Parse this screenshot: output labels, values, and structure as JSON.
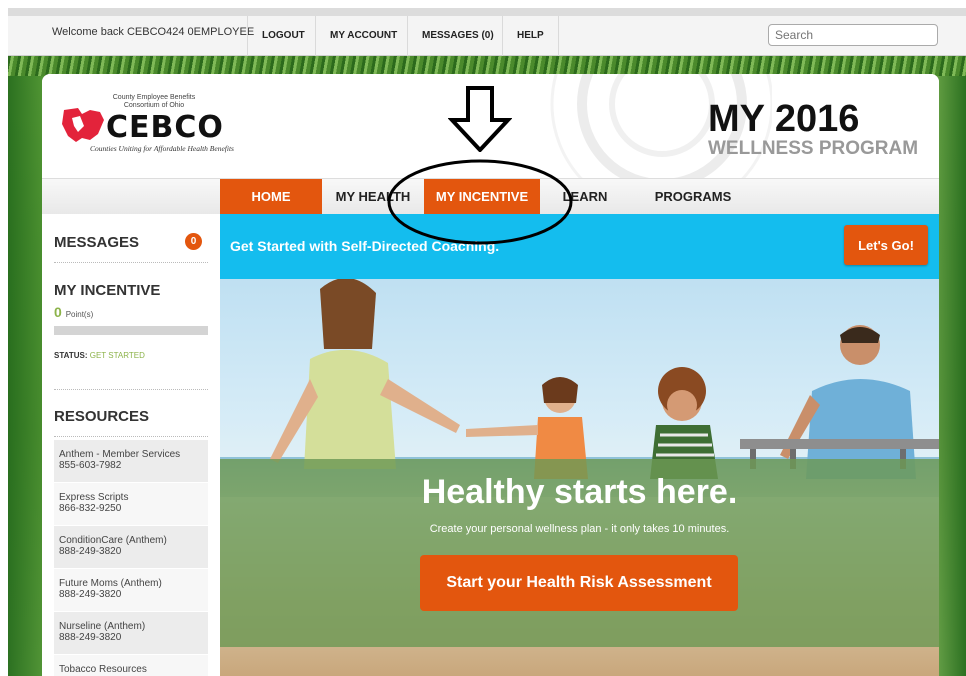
{
  "topbar": {
    "welcome": "Welcome back  CEBCO424 0EMPLOYEE",
    "links": [
      "LOGOUT",
      "MY ACCOUNT",
      "MESSAGES (0)",
      "HELP"
    ],
    "search_placeholder": "Search"
  },
  "header": {
    "logo_top": "County Employee Benefits Consortium of Ohio",
    "logo_name": "CEBCO",
    "logo_tagline": "Counties Uniting for Affordable Health Benefits",
    "title_year": "MY 2016",
    "title_sub": "WELLNESS PROGRAM"
  },
  "nav": {
    "items": [
      "HOME",
      "MY HEALTH",
      "MY INCENTIVE",
      "LEARN",
      "PROGRAMS"
    ],
    "active": "HOME"
  },
  "sidebar": {
    "messages_label": "MESSAGES",
    "messages_count": "0",
    "incentive_label": "MY INCENTIVE",
    "points_value": "0",
    "points_unit": "Point(s)",
    "points_progress": 0,
    "status_label": "STATUS:",
    "status_value": "GET STARTED",
    "resources_label": "RESOURCES",
    "resources": [
      {
        "name": "Anthem - Member Services",
        "phone": "855-603-7982"
      },
      {
        "name": "Express Scripts",
        "phone": "866-832-9250"
      },
      {
        "name": "ConditionCare (Anthem)",
        "phone": "888-249-3820"
      },
      {
        "name": "Future Moms (Anthem)",
        "phone": "888-249-3820"
      },
      {
        "name": "Nurseline (Anthem)",
        "phone": "888-249-3820"
      },
      {
        "name": "Tobacco Resources",
        "phone": ""
      }
    ]
  },
  "banner": {
    "text": "Get Started with Self-Directed Coaching.",
    "button": "Let's Go!"
  },
  "hero": {
    "headline": "Healthy starts here.",
    "subtext": "Create your personal wellness plan - it only takes 10 minutes.",
    "cta": "Start your Health Risk Assessment"
  },
  "colors": {
    "accent_orange": "#e3560e",
    "banner_blue": "#14bdee",
    "green": "#8cb34a"
  }
}
